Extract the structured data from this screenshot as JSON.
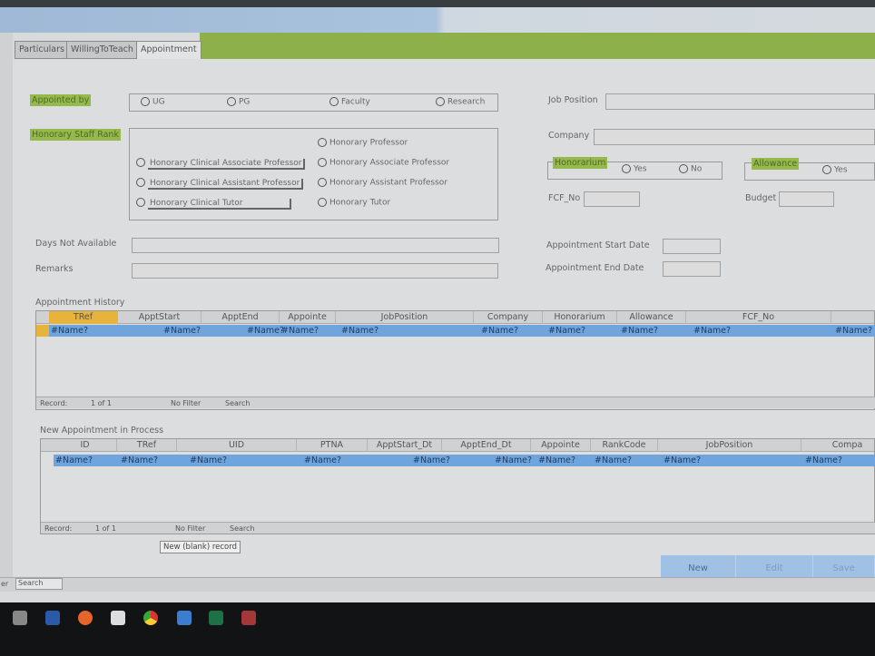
{
  "tabs": [
    {
      "label": "Particulars"
    },
    {
      "label": "WillingToTeach"
    },
    {
      "label": "Appointment"
    }
  ],
  "appointed_by": {
    "label": "Appointed by",
    "options": [
      "UG",
      "PG",
      "Faculty",
      "Research"
    ]
  },
  "rank": {
    "label": "Honorary Staff Rank",
    "options_left": [
      "Honorary Clinical Associate Professor",
      "Honorary Clinical Assistant Professor",
      "Honorary Clinical Tutor"
    ],
    "options_right": [
      "Honorary Professor",
      "Honorary Associate Professor",
      "Honorary Assistant Professor",
      "Honorary Tutor"
    ]
  },
  "fields": {
    "job_position": "Job Position",
    "company": "Company",
    "fcf_no": "FCF_No",
    "budget": "Budget",
    "days_not_available": "Days Not Available",
    "remarks": "Remarks",
    "start_date": "Appointment Start Date",
    "end_date": "Appointment End Date"
  },
  "honorarium": {
    "label": "Honorarium",
    "yes": "Yes",
    "no": "No"
  },
  "allowance": {
    "label": "Allowance",
    "yes": "Yes"
  },
  "history": {
    "title": "Appointment History",
    "columns": [
      "TRef",
      "ApptStart",
      "ApptEnd",
      "Appointe",
      "JobPosition",
      "Company",
      "Honorarium",
      "Allowance",
      "FCF_No",
      ""
    ],
    "row": [
      "#Name?",
      "#Name?",
      "#Name?",
      "#Name?",
      "#Name?",
      "#Name?",
      "#Name?",
      "#Name?",
      "#Name?",
      "#Name?"
    ],
    "nav": {
      "record": "Record:",
      "pos": "1 of 1",
      "filter": "No Filter",
      "search": "Search"
    }
  },
  "process": {
    "title": "New Appointment in Process",
    "columns": [
      "ID",
      "TRef",
      "UID",
      "PTNA",
      "ApptStart_Dt",
      "ApptEnd_Dt",
      "Appointe",
      "RankCode",
      "JobPosition",
      "Compa"
    ],
    "row": [
      "#Name?",
      "#Name?",
      "#Name?",
      "#Name?",
      "#Name?",
      "#Name?",
      "#Name?",
      "#Name?",
      "#Name?",
      "#Name?"
    ],
    "nav": {
      "record": "Record:",
      "pos": "1 of 1",
      "filter": "No Filter",
      "search": "Search"
    },
    "tooltip": "New (blank) record"
  },
  "buttons": {
    "new": "New",
    "edit": "Edit",
    "save": "Save"
  },
  "status": {
    "search": "Search",
    "left": "er"
  },
  "taskbar": [
    "calculator-icon",
    "file-explorer-icon",
    "firefox-icon",
    "notes-icon",
    "chrome-icon",
    "photos-icon",
    "excel-icon",
    "access-icon"
  ]
}
